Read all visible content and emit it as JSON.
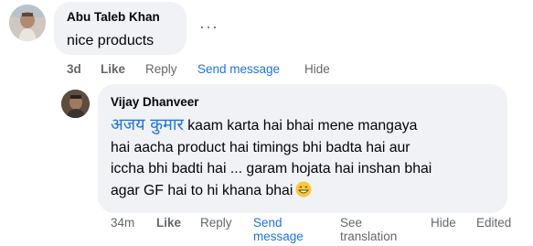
{
  "comments": [
    {
      "author": "Abu Taleb Khan",
      "text": "nice products",
      "actions": {
        "time": "3d",
        "like": "Like",
        "reply": "Reply",
        "send": "Send message",
        "hide": "Hide"
      }
    },
    {
      "author": "Vijay Dhanveer",
      "mention": "अजय कुमार",
      "text_lines": [
        " kaam karta hai bhai mene mangaya",
        "hai aacha product hai timings bhi badta hai aur",
        "iccha bhi badti hai ... garam hojata hai inshan bhai",
        "agar GF hai to hi khana bhai"
      ],
      "emoji": "grinning-face-with-smiling-eyes",
      "actions": {
        "time": "34m",
        "like": "Like",
        "reply": "Reply",
        "send": "Send message",
        "see_translation": "See translation",
        "hide": "Hide",
        "edited": "Edited"
      }
    }
  ],
  "more_icon": "ellipsis-icon",
  "colors": {
    "bubble": "#f0f2f5",
    "link": "#1b74e4",
    "meta": "#65676b",
    "text": "#050505"
  }
}
